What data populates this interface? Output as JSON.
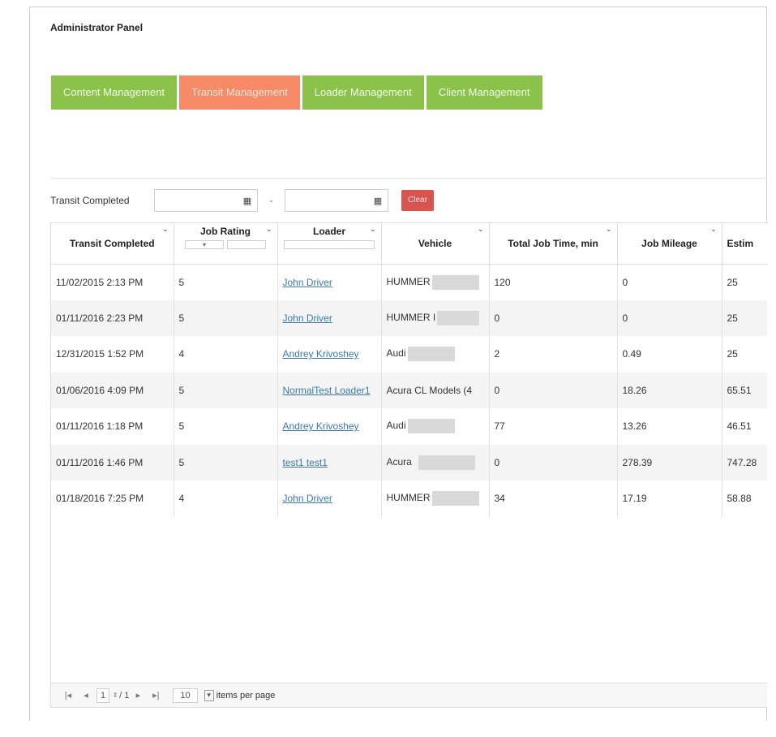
{
  "panel_title": "Administrator Panel",
  "tabs": [
    {
      "label": "Content Management",
      "active": false
    },
    {
      "label": "Transit Management",
      "active": true
    },
    {
      "label": "Loader Management",
      "active": false
    },
    {
      "label": "Client Management",
      "active": false
    }
  ],
  "filter": {
    "label": "Transit Completed",
    "separator": "-",
    "clear_label": "Clear"
  },
  "grid": {
    "columns": [
      "Transit Completed",
      "Job Rating",
      "Loader",
      "Vehicle",
      "Total Job Time, min",
      "Job Mileage",
      "Estim"
    ],
    "rows": [
      {
        "transit_completed": "11/02/2015 2:13 PM",
        "job_rating": "5",
        "loader": "John Driver",
        "vehicle": "HUMMER",
        "total_job_time": "120",
        "job_mileage": "0",
        "estim": "25"
      },
      {
        "transit_completed": "01/11/2016 2:23 PM",
        "job_rating": "5",
        "loader": "John Driver",
        "vehicle": "HUMMER I",
        "total_job_time": "0",
        "job_mileage": "0",
        "estim": "25"
      },
      {
        "transit_completed": "12/31/2015 1:52 PM",
        "job_rating": "4",
        "loader": "Andrey Krivoshey",
        "vehicle": "Audi",
        "total_job_time": "2",
        "job_mileage": "0.49",
        "estim": "25"
      },
      {
        "transit_completed": "01/06/2016 4:09 PM",
        "job_rating": "5",
        "loader": "NormalTest Loader1",
        "vehicle": "Acura CL Models (4",
        "total_job_time": "0",
        "job_mileage": "18.26",
        "estim": "65.51"
      },
      {
        "transit_completed": "01/11/2016 1:18 PM",
        "job_rating": "5",
        "loader": "Andrey Krivoshey",
        "vehicle": "Audi",
        "total_job_time": "77",
        "job_mileage": "13.26",
        "estim": "46.51"
      },
      {
        "transit_completed": "01/11/2016 1:46 PM",
        "job_rating": "5",
        "loader": "test1 test1",
        "vehicle": "Acura",
        "total_job_time": "0",
        "job_mileage": "278.39",
        "estim": "747.28"
      },
      {
        "transit_completed": "01/18/2016 7:25 PM",
        "job_rating": "4",
        "loader": "John Driver",
        "vehicle": "HUMMER",
        "total_job_time": "34",
        "job_mileage": "17.19",
        "estim": "58.88"
      }
    ]
  },
  "pager": {
    "page": "1",
    "of_pages": "/ 1",
    "page_size": "10",
    "items_per_page_label": "items per page"
  }
}
